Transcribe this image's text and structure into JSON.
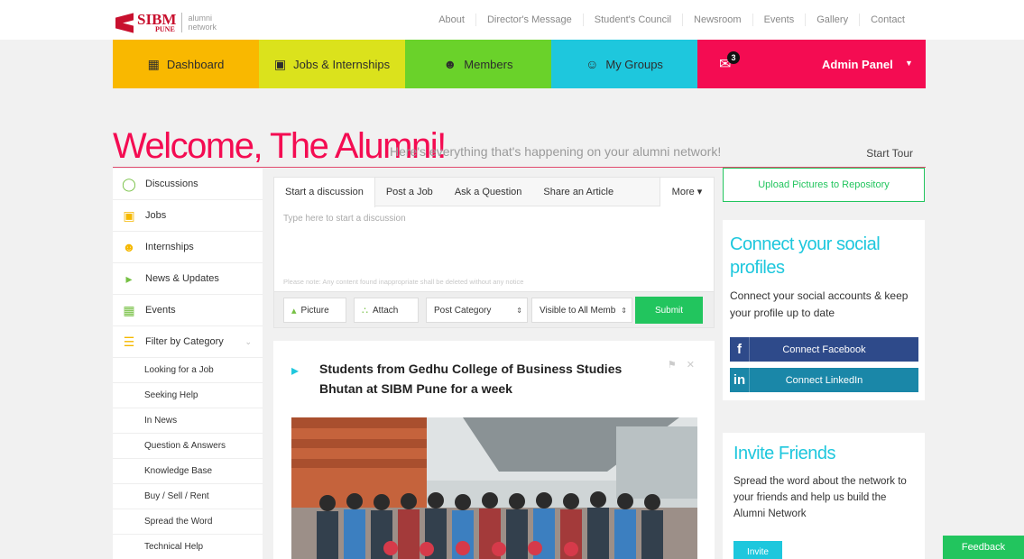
{
  "brand": {
    "name": "SIBM",
    "sub": "PUNE",
    "network_line1": "alumni",
    "network_line2": "network"
  },
  "topnav": [
    "About",
    "Director's Message",
    "Student's Council",
    "Newsroom",
    "Events",
    "Gallery",
    "Contact"
  ],
  "mainnav": {
    "dashboard": "Dashboard",
    "jobs": "Jobs & Internships",
    "members": "Members",
    "groups": "My Groups",
    "mail_count": "3",
    "admin": "Admin Panel"
  },
  "welcome": {
    "title": "Welcome, The Alumni!",
    "subtitle": "Here's everything that's happening on your alumni network!",
    "tour": "Start Tour"
  },
  "sidebar": {
    "items": [
      "Discussions",
      "Jobs",
      "Internships",
      "News & Updates",
      "Events",
      "Filter by Category"
    ],
    "categories": [
      "Looking for a Job",
      "Seeking Help",
      "In News",
      "Question & Answers",
      "Knowledge Base",
      "Buy / Sell / Rent",
      "Spread the Word",
      "Technical Help"
    ]
  },
  "composer": {
    "tabs": [
      "Start a discussion",
      "Post a Job",
      "Ask a Question",
      "Share an Article"
    ],
    "more": "More",
    "placeholder": "Type here to start a discussion",
    "note": "Please note: Any content found inappropriate shall be deleted without any notice",
    "picture": "Picture",
    "attach": "Attach",
    "category_select": "Post Category",
    "visibility_select": "Visible to All Memb",
    "submit": "Submit"
  },
  "post": {
    "title": "Students from Gedhu College of Business Studies Bhutan at SIBM Pune for a week"
  },
  "right": {
    "upload": "Upload Pictures to Repository",
    "social_title": "Connect your social profiles",
    "social_text": "Connect your social accounts & keep your profile up to date",
    "facebook": "Connect Facebook",
    "linkedin": "Connect LinkedIn",
    "invite_title": "Invite Friends",
    "invite_text": "Spread the word about the network to your friends and help us build the Alumni Network",
    "invite_button": "Invite"
  },
  "feedback": "Feedback",
  "colors": {
    "dashboard": "#f9b800",
    "jobs": "#dbe21c",
    "members": "#6ad22a",
    "groups": "#1ec7dd",
    "admin": "#f40c52",
    "accent_green": "#22c55e"
  }
}
